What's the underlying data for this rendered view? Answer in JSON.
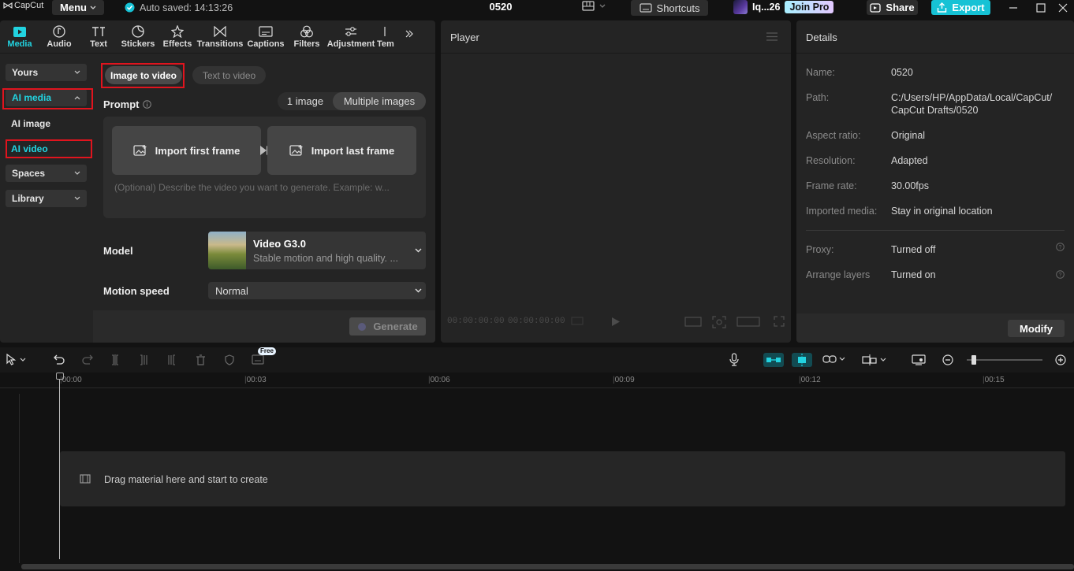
{
  "topbar": {
    "logo": "CapCut",
    "menu": "Menu",
    "autosave": "Auto saved: 14:13:26",
    "project_title": "0520",
    "shortcuts": "Shortcuts",
    "user": "Iq...26",
    "join_pro": "Join Pro",
    "share": "Share",
    "export": "Export",
    "accent_color": "#16c2d5"
  },
  "tabs": [
    "Media",
    "Audio",
    "Text",
    "Stickers",
    "Effects",
    "Transitions",
    "Captions",
    "Filters",
    "Adjustment",
    "Tem"
  ],
  "sidebar": {
    "yours": "Yours",
    "ai_media": "AI media",
    "ai_image": "AI image",
    "ai_video": "AI video",
    "spaces": "Spaces",
    "library": "Library"
  },
  "generator": {
    "mode_image": "Image to video",
    "mode_text": "Text to video",
    "prompt_label": "Prompt",
    "one_image": "1 image",
    "multiple_images": "Multiple images",
    "import_first": "Import first frame",
    "import_last": "Import last frame",
    "prompt_placeholder": "(Optional) Describe the video you want to generate. Example: w...",
    "model_label": "Model",
    "model_name": "Video G3.0",
    "model_desc": "Stable motion and high quality. ...",
    "motion_label": "Motion speed",
    "motion_value": "Normal",
    "generate": "Generate"
  },
  "player": {
    "title": "Player",
    "time_current": "00:00:00:00",
    "time_total": "00:00:00:00"
  },
  "details": {
    "title": "Details",
    "rows": [
      {
        "label": "Name:",
        "value": "0520"
      },
      {
        "label": "Path:",
        "value": "C:/Users/HP/AppData/Local/CapCut/\nCapCut Drafts/0520"
      },
      {
        "label": "Aspect ratio:",
        "value": "Original"
      },
      {
        "label": "Resolution:",
        "value": "Adapted"
      },
      {
        "label": "Frame rate:",
        "value": "30.00fps"
      },
      {
        "label": "Imported media:",
        "value": "Stay in original location"
      },
      {
        "label": "Proxy:",
        "value": "Turned off"
      },
      {
        "label": "Arrange layers",
        "value": "Turned on"
      }
    ],
    "modify": "Modify"
  },
  "timeline": {
    "free_badge": "Free",
    "ticks": [
      "00:00",
      "00:03",
      "00:06",
      "00:09",
      "00:12",
      "00:15"
    ],
    "drop_hint": "Drag material here and start to create"
  }
}
